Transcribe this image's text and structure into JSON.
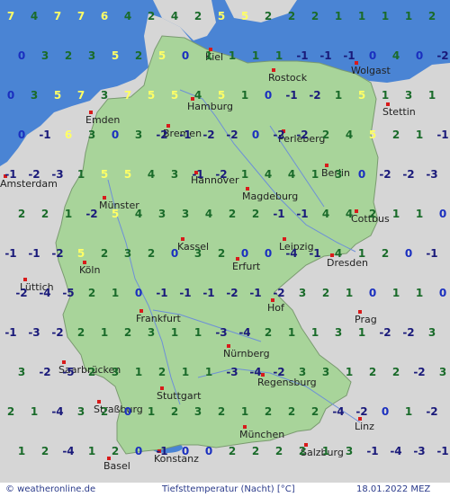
{
  "colors": {
    "sea": "#4a84d4",
    "land_outside": "#d6d6d6",
    "germany": "#a8d49a",
    "river": "#6d8fd8",
    "city_marker": "#d81b1b",
    "temp_warm": "#ffff66",
    "temp_mild": "#1a6b2a",
    "temp_zero": "#1a2fbf",
    "temp_cold": "#1a1a7a"
  },
  "cities": [
    {
      "name": "Kiel"
    },
    {
      "name": "Rostock"
    },
    {
      "name": "Wolgast"
    },
    {
      "name": "Hamburg"
    },
    {
      "name": "Emden"
    },
    {
      "name": "Stettin"
    },
    {
      "name": "Bremen"
    },
    {
      "name": "Perleberg"
    },
    {
      "name": "Amsterdam"
    },
    {
      "name": "Hannover"
    },
    {
      "name": "Berlin"
    },
    {
      "name": "Magdeburg"
    },
    {
      "name": "Münster"
    },
    {
      "name": "Cottbus"
    },
    {
      "name": "Kassel"
    },
    {
      "name": "Leipzig"
    },
    {
      "name": "Köln"
    },
    {
      "name": "Erfurt"
    },
    {
      "name": "Dresden"
    },
    {
      "name": "Lüttich"
    },
    {
      "name": "Hof"
    },
    {
      "name": "Frankfurt"
    },
    {
      "name": "Prag"
    },
    {
      "name": "Nürnberg"
    },
    {
      "name": "Saarbrücken"
    },
    {
      "name": "Regensburg"
    },
    {
      "name": "Stuttgart"
    },
    {
      "name": "Straßburg"
    },
    {
      "name": "Linz"
    },
    {
      "name": "München"
    },
    {
      "name": "Salzburg"
    },
    {
      "name": "Basel"
    },
    {
      "name": "Konstanz"
    }
  ],
  "temperatures": [
    "7",
    "4",
    "7",
    "7",
    "6",
    "4",
    "2",
    "4",
    "2",
    "5",
    "5",
    "2",
    "2",
    "2",
    "1",
    "1",
    "1",
    "1",
    "2",
    "0",
    "3",
    "2",
    "3",
    "5",
    "2",
    "5",
    "0",
    "1",
    "1",
    "1",
    "1",
    "-1",
    "-1",
    "-1",
    "0",
    "4",
    "0",
    "-2",
    "0",
    "3",
    "5",
    "7",
    "3",
    "7",
    "5",
    "5",
    "4",
    "5",
    "1",
    "0",
    "-1",
    "-2",
    "1",
    "5",
    "1",
    "3",
    "1",
    "0",
    "-1",
    "6",
    "3",
    "0",
    "3",
    "-2",
    "-1",
    "-2",
    "-2",
    "0",
    "-2",
    "-2",
    "2",
    "4",
    "5",
    "2",
    "1",
    "-1",
    "-1",
    "-2",
    "-3",
    "1",
    "5",
    "5",
    "4",
    "3",
    "-1",
    "-2",
    "1",
    "4",
    "4",
    "1",
    "3",
    "0",
    "-2",
    "-2",
    "-3",
    "2",
    "2",
    "1",
    "-2",
    "5",
    "4",
    "3",
    "3",
    "4",
    "2",
    "2",
    "-1",
    "-1",
    "4",
    "4",
    "2",
    "1",
    "1",
    "0",
    "-1",
    "-1",
    "-2",
    "5",
    "2",
    "3",
    "2",
    "0",
    "3",
    "2",
    "0",
    "0",
    "-4",
    "-1",
    "4",
    "1",
    "2",
    "0",
    "-1",
    "-2",
    "-4",
    "-5",
    "2",
    "1",
    "0",
    "-1",
    "-1",
    "-1",
    "-2",
    "-1",
    "-2",
    "3",
    "2",
    "1",
    "0",
    "1",
    "1",
    "0",
    "-1",
    "-3",
    "-2",
    "2",
    "1",
    "2",
    "3",
    "1",
    "1",
    "-3",
    "-4",
    "2",
    "1",
    "1",
    "3",
    "1",
    "-2",
    "-2",
    "3",
    "3",
    "-2",
    "-5",
    "2",
    "3",
    "1",
    "2",
    "1",
    "1",
    "-3",
    "-4",
    "-2",
    "3",
    "3",
    "1",
    "2",
    "2",
    "-2",
    "3",
    "2",
    "1",
    "-4",
    "3",
    "2",
    "0",
    "1",
    "2",
    "3",
    "2",
    "1",
    "2",
    "2",
    "2",
    "-4",
    "-2",
    "0",
    "1",
    "-2",
    "1",
    "2",
    "-4",
    "1",
    "2",
    "0",
    "-1",
    "0",
    "0",
    "2",
    "2",
    "2",
    "2",
    "1",
    "3",
    "-1",
    "-4",
    "-3",
    "-1",
    "-5",
    "-3",
    "-2"
  ],
  "footer": {
    "credit": "© weatheronline.de",
    "caption": "Tiefsttemperatur (Nacht) [°C]",
    "date": "18.01.2022 MEZ"
  }
}
